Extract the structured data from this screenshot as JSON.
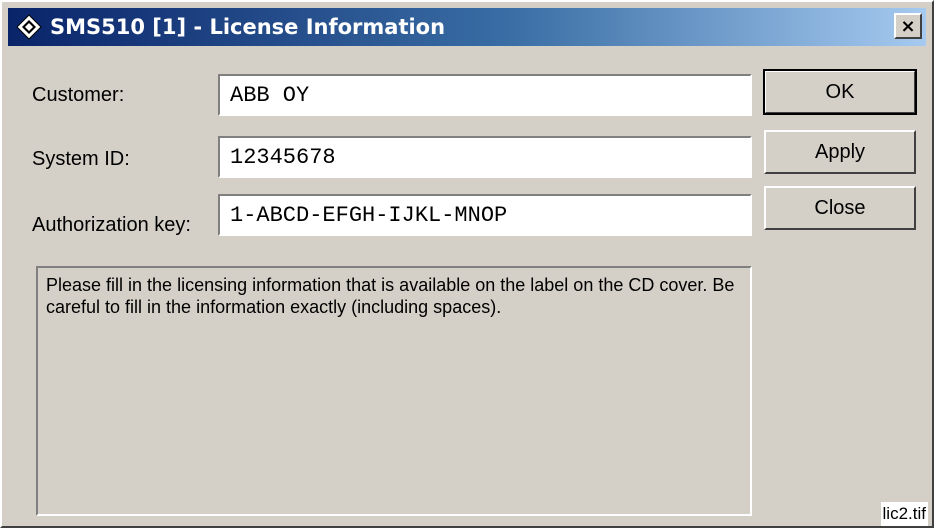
{
  "window": {
    "title": "SMS510 [1] - License Information",
    "icon": "app-diamond-icon",
    "close_glyph": "×"
  },
  "form": {
    "customer_label": "Customer:",
    "customer_value": "ABB OY",
    "system_id_label": "System ID:",
    "system_id_value": "12345678",
    "auth_key_label": "Authorization key:",
    "auth_key_value": "1-ABCD-EFGH-IJKL-MNOP"
  },
  "buttons": {
    "ok": "OK",
    "apply": "Apply",
    "close": "Close"
  },
  "info_text": "Please fill in the licensing information that is available on the label on the CD cover. Be careful to fill in the information exactly (including spaces).",
  "caption": "lic2.tif",
  "colors": {
    "dialog_bg": "#d4d0c8",
    "title_start": "#0a246a",
    "title_end": "#a6caf0"
  }
}
